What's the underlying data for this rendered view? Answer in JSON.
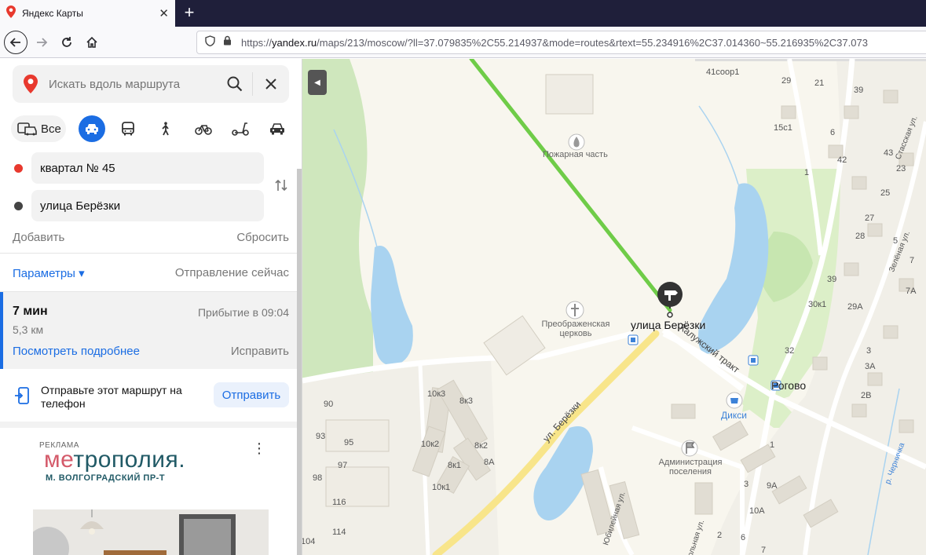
{
  "browser": {
    "tab_title": "Яндекс Карты",
    "url_prefix": "https://",
    "url_domain": "yandex.ru",
    "url_rest": "/maps/213/moscow/?ll=37.079835%2C55.214937&mode=routes&rtext=55.234916%2C37.014360~55.216935%2C37.073"
  },
  "search": {
    "placeholder": "Искать вдоль маршрута"
  },
  "modes": {
    "all_label": "Все"
  },
  "route": {
    "from": "квартал № 45",
    "to": "улица Берёзки",
    "add_label": "Добавить",
    "reset_label": "Сбросить",
    "params_label": "Параметры ▾",
    "depart_label": "Отправление сейчас"
  },
  "result": {
    "time": "7 мин",
    "arrival": "Прибытие в 09:04",
    "distance": "5,3 км",
    "details_link": "Посмотреть подробнее",
    "fix_link": "Исправить"
  },
  "send": {
    "text": "Отправьте этот маршрут на телефон",
    "button": "Отправить"
  },
  "ad": {
    "label": "РЕКЛАМА",
    "brand_accent": "ме",
    "brand_rest": "трополия.",
    "subtitle": "М. ВОЛГОГРАДСКИЙ ПР-Т"
  },
  "map": {
    "destination_label": "улица Берёзки",
    "village": "Рогово",
    "poi_fire": "Пожарная часть",
    "poi_church": "Преображенская церковь",
    "poi_shop": "Дикси",
    "poi_admin": "Администрация поселения",
    "street_berezki": "ул. Берёзки",
    "street_trakt": "Калужский тракт",
    "street_yubil": "Юбилейная ул.",
    "street_shkol": "Школьная ул.",
    "street_stas": "Стасская ул.",
    "street_zelen": "Зелёная ул.",
    "river": "р. Черничка",
    "house_numbers": {
      "n41s1": "41соор1",
      "n29": "29",
      "n21": "21",
      "n39a": "39",
      "n15s1": "15с1",
      "n6": "6",
      "n42": "42",
      "n43": "43",
      "n1": "1",
      "n23": "23",
      "n25": "25",
      "n27": "27",
      "n28": "28",
      "n5": "5",
      "n7": "7",
      "n39b": "39",
      "n7a": "7А",
      "n30k1": "30к1",
      "n29a": "29А",
      "n32": "32",
      "n3": "3",
      "n3a": "3А",
      "n2v": "2В",
      "n10k3": "10к3",
      "n8k3": "8к3",
      "n90": "90",
      "n93": "93",
      "n95": "95",
      "n97": "97",
      "n10k2": "10к2",
      "n8k2": "8к2",
      "n8k1": "8к1",
      "n8a": "8А",
      "n98": "98",
      "n10k1": "10к1",
      "n116": "116",
      "n114": "114",
      "n104": "104",
      "n1b": "1",
      "n9a": "9А",
      "n10a": "10А",
      "n3b": "3",
      "n6b": "6",
      "n7b": "7",
      "n2": "2"
    }
  }
}
